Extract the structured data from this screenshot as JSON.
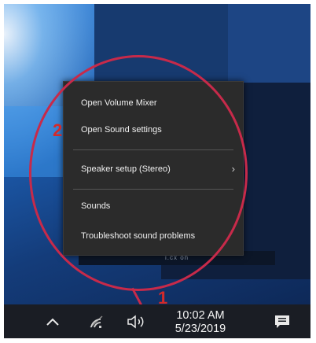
{
  "context_menu": {
    "items": [
      {
        "label": "Open Volume Mixer"
      },
      {
        "label": "Open Sound settings"
      },
      {
        "label": "Speaker setup (Stereo)",
        "submenu": true
      },
      {
        "label": "Sounds"
      },
      {
        "label": "Troubleshoot sound problems"
      }
    ]
  },
  "annotations": {
    "step_1": "1",
    "step_2": "2",
    "highlight_color": "#c72a4a"
  },
  "background_window": {
    "partial_text": "i.cx on"
  },
  "taskbar": {
    "icons": [
      "chevron-up-icon",
      "wifi-icon",
      "speaker-icon",
      "notification-icon"
    ],
    "clock": {
      "time": "10:02 AM",
      "date": "5/23/2019"
    }
  }
}
